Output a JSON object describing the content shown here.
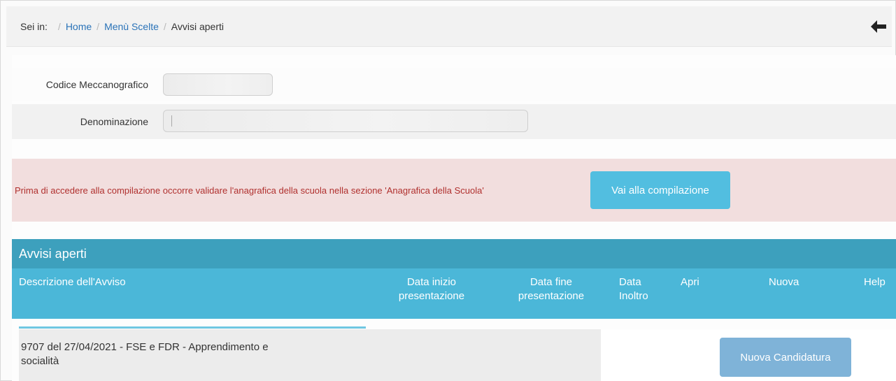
{
  "breadcrumb": {
    "prefix": "Sei in:",
    "items": [
      "Home",
      "Menù Scelte",
      "Avvisi aperti"
    ],
    "separator": "/"
  },
  "form": {
    "codice_label": "Codice Meccanografico",
    "codice_value": "",
    "denominazione_label": "Denominazione",
    "denominazione_value": ""
  },
  "alert": {
    "message": "Prima di accedere alla compilazione occorre validare l'anagrafica della scuola nella sezione 'Anagrafica della Scuola'",
    "button_label": "Vai alla compilazione"
  },
  "table": {
    "title": "Avvisi aperti",
    "headers": {
      "descrizione": "Descrizione dell'Avviso",
      "data_inizio_1": "Data inizio",
      "data_inizio_2": "presentazione",
      "data_fine_1": "Data fine",
      "data_fine_2": "presentazione",
      "data_inoltro_1": "Data",
      "data_inoltro_2": "Inoltro",
      "apri": "Apri",
      "nuova": "Nuova",
      "help": "Help"
    },
    "rows": [
      {
        "descrizione_1": "9707 del 27/04/2021 - FSE e FDR - Apprendimento e",
        "descrizione_2": "socialità",
        "nuova_button": "Nuova Candidatura"
      }
    ]
  },
  "colors": {
    "link": "#2a73b8",
    "alert_bg": "#f2dede",
    "alert_text": "#b0302e",
    "info_button": "#52bee0",
    "table_title_bg": "#3da0bd",
    "table_header_bg": "#4bb7d8",
    "nuova_button": "#7fb3d8"
  },
  "icons": {
    "back": "arrow-left-icon"
  }
}
